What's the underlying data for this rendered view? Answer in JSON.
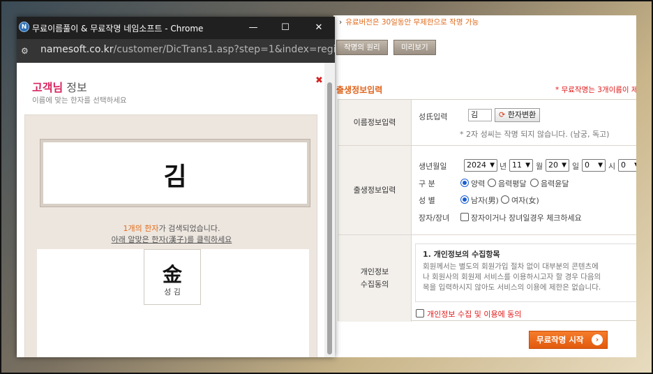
{
  "window": {
    "title": "무료이름풀이 & 무료작명 네임소프트 - Chrome",
    "app_icon_letter": "N",
    "minimize_glyph": "—",
    "maximize_glyph": "☐",
    "close_glyph": "✕"
  },
  "urlbar": {
    "domain": "namesoft.co.kr",
    "path": "/customer/DicTrans1.asp?step=1&index=regist..."
  },
  "popup": {
    "title_main": "고객님",
    "title_rest": " 정보",
    "subtitle": "이름에 맞는 한자를 선택하세요",
    "close_mark": "✖",
    "name_display": "김",
    "found_count": "1개의 한자",
    "found_rest": "가 검색되었습니다.",
    "instruction": "아래 알맞은 한자(漢子)를 클릭하세요",
    "hanja_options": [
      {
        "hanja": "金",
        "reading": "성 김"
      }
    ]
  },
  "page": {
    "notice": "유료버전은 30일동안 무제한으로 작명 가능",
    "tab_principle": "작명의 원리",
    "tab_preview": "미리보기",
    "section_title": "출생정보입력",
    "section_note": "* 무료작명는 3개이름이 제공",
    "name_row": {
      "head": "이름정보입력",
      "surname_label": "성氏입력",
      "surname_value": "김",
      "convert_button": "한자변환",
      "note": "* 2자 성씨는 작명 되지 않습니다. (남궁, 독고)"
    },
    "birth_row": {
      "head": "출생정보입력",
      "date_label": "생년월일",
      "year": "2024",
      "year_unit": "년",
      "month": "11",
      "month_unit": "월",
      "day": "20",
      "day_unit": "일",
      "hour": "0",
      "hour_unit": "시",
      "minute": "0",
      "type_label": "구 분",
      "type_solar": "양력",
      "type_lunar_normal": "음력평달",
      "type_lunar_leap": "음력윤달",
      "gender_label": "성 별",
      "gender_male": "남자(男)",
      "gender_female": "여자(女)",
      "eldest_label": "장자/장녀",
      "eldest_check": "장자이거나 장녀일경우 체크하세요"
    },
    "privacy_row": {
      "head_line1": "개인정보",
      "head_line2": "수집동의",
      "box_title": "1. 개인정보의 수집항목",
      "box_line1": "회원께서는 별도의 회원가입 절차 없이 대부분의 콘텐츠에",
      "box_line2": "나 회원사의 회원제 서비스를 이용하시고자 할 경우 다음의",
      "box_line3": "목을 입력하시지 않아도 서비스의 이용에 제한은 없습니다.",
      "agree": "개인정보 수집 및 이용에 동의"
    },
    "start_button": "무료작명 시작",
    "start_arrow": "›"
  }
}
